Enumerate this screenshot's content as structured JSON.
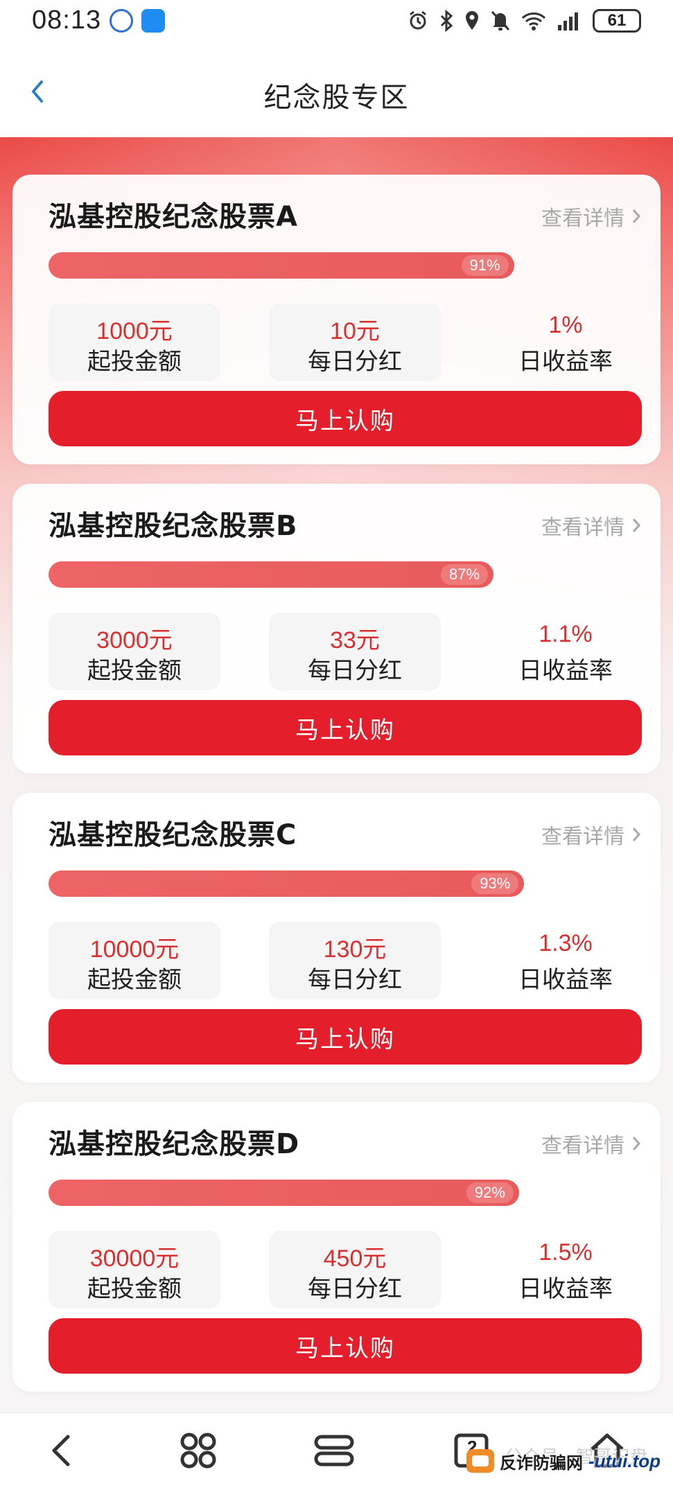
{
  "status_bar": {
    "time": "08:13",
    "battery": "61",
    "icons": [
      "alarm-icon",
      "bluetooth-icon",
      "location-icon",
      "mute-icon",
      "wifi-icon",
      "signal-icon"
    ]
  },
  "header": {
    "title": "纪念股专区"
  },
  "cards": [
    {
      "title": "泓基控股纪念股票A",
      "detail": "查看详情",
      "progress": 91,
      "progress_label": "91%",
      "stats": [
        {
          "value": "1000元",
          "label": "起投金额"
        },
        {
          "value": "10元",
          "label": "每日分红"
        },
        {
          "value": "1%",
          "label": "日收益率"
        }
      ],
      "button": "马上认购"
    },
    {
      "title": "泓基控股纪念股票B",
      "detail": "查看详情",
      "progress": 87,
      "progress_label": "87%",
      "stats": [
        {
          "value": "3000元",
          "label": "起投金额"
        },
        {
          "value": "33元",
          "label": "每日分红"
        },
        {
          "value": "1.1%",
          "label": "日收益率"
        }
      ],
      "button": "马上认购"
    },
    {
      "title": "泓基控股纪念股票C",
      "detail": "查看详情",
      "progress": 93,
      "progress_label": "93%",
      "stats": [
        {
          "value": "10000元",
          "label": "起投金额"
        },
        {
          "value": "130元",
          "label": "每日分红"
        },
        {
          "value": "1.3%",
          "label": "日收益率"
        }
      ],
      "button": "马上认购"
    },
    {
      "title": "泓基控股纪念股票D",
      "detail": "查看详情",
      "progress": 92,
      "progress_label": "92%",
      "stats": [
        {
          "value": "30000元",
          "label": "起投金额"
        },
        {
          "value": "450元",
          "label": "每日分红"
        },
        {
          "value": "1.5%",
          "label": "日收益率"
        }
      ],
      "button": "马上认购"
    }
  ],
  "navbar": {
    "items": [
      "back-icon",
      "apps-icon",
      "menu-icon",
      "tabs-icon",
      "home-icon"
    ],
    "tab_count": "2"
  },
  "watermark": {
    "faint": "公众号 · 智哥识盘",
    "text": "反诈防骗网",
    "domain": "-utui.top"
  },
  "colors": {
    "accent": "#e51e2b",
    "value_red": "#d9302f",
    "progress": "#e85b5c",
    "header_band": "#ea4a46"
  }
}
